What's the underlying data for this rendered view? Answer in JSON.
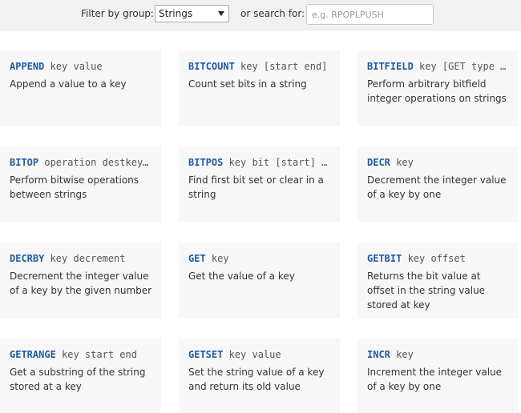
{
  "filter": {
    "group_label": "Filter by group:",
    "group_selected": "Strings",
    "search_label": "or search for:",
    "search_placeholder": "e.g. RPOPLPUSH",
    "search_value": ""
  },
  "commands": [
    {
      "name": "APPEND",
      "args": " key value",
      "desc": "Append a value to a key"
    },
    {
      "name": "BITCOUNT",
      "args": " key [start end]",
      "desc": "Count set bits in a string"
    },
    {
      "name": "BITFIELD",
      "args": " key [GET type …",
      "desc": "Perform arbitrary bitfield integer operations on strings"
    },
    {
      "name": "BITOP",
      "args": " operation destkey…",
      "desc": "Perform bitwise operations between strings"
    },
    {
      "name": "BITPOS",
      "args": " key bit [start] …",
      "desc": "Find first bit set or clear in a string"
    },
    {
      "name": "DECR",
      "args": " key",
      "desc": "Decrement the integer value of a key by one"
    },
    {
      "name": "DECRBY",
      "args": " key decrement",
      "desc": "Decrement the integer value of a key by the given number"
    },
    {
      "name": "GET",
      "args": " key",
      "desc": "Get the value of a key"
    },
    {
      "name": "GETBIT",
      "args": " key offset",
      "desc": "Returns the bit value at offset in the string value stored at key"
    },
    {
      "name": "GETRANGE",
      "args": " key start end",
      "desc": "Get a substring of the string stored at a key"
    },
    {
      "name": "GETSET",
      "args": " key value",
      "desc": "Set the string value of a key and return its old value"
    },
    {
      "name": "INCR",
      "args": " key",
      "desc": "Increment the integer value of a key by one"
    }
  ]
}
